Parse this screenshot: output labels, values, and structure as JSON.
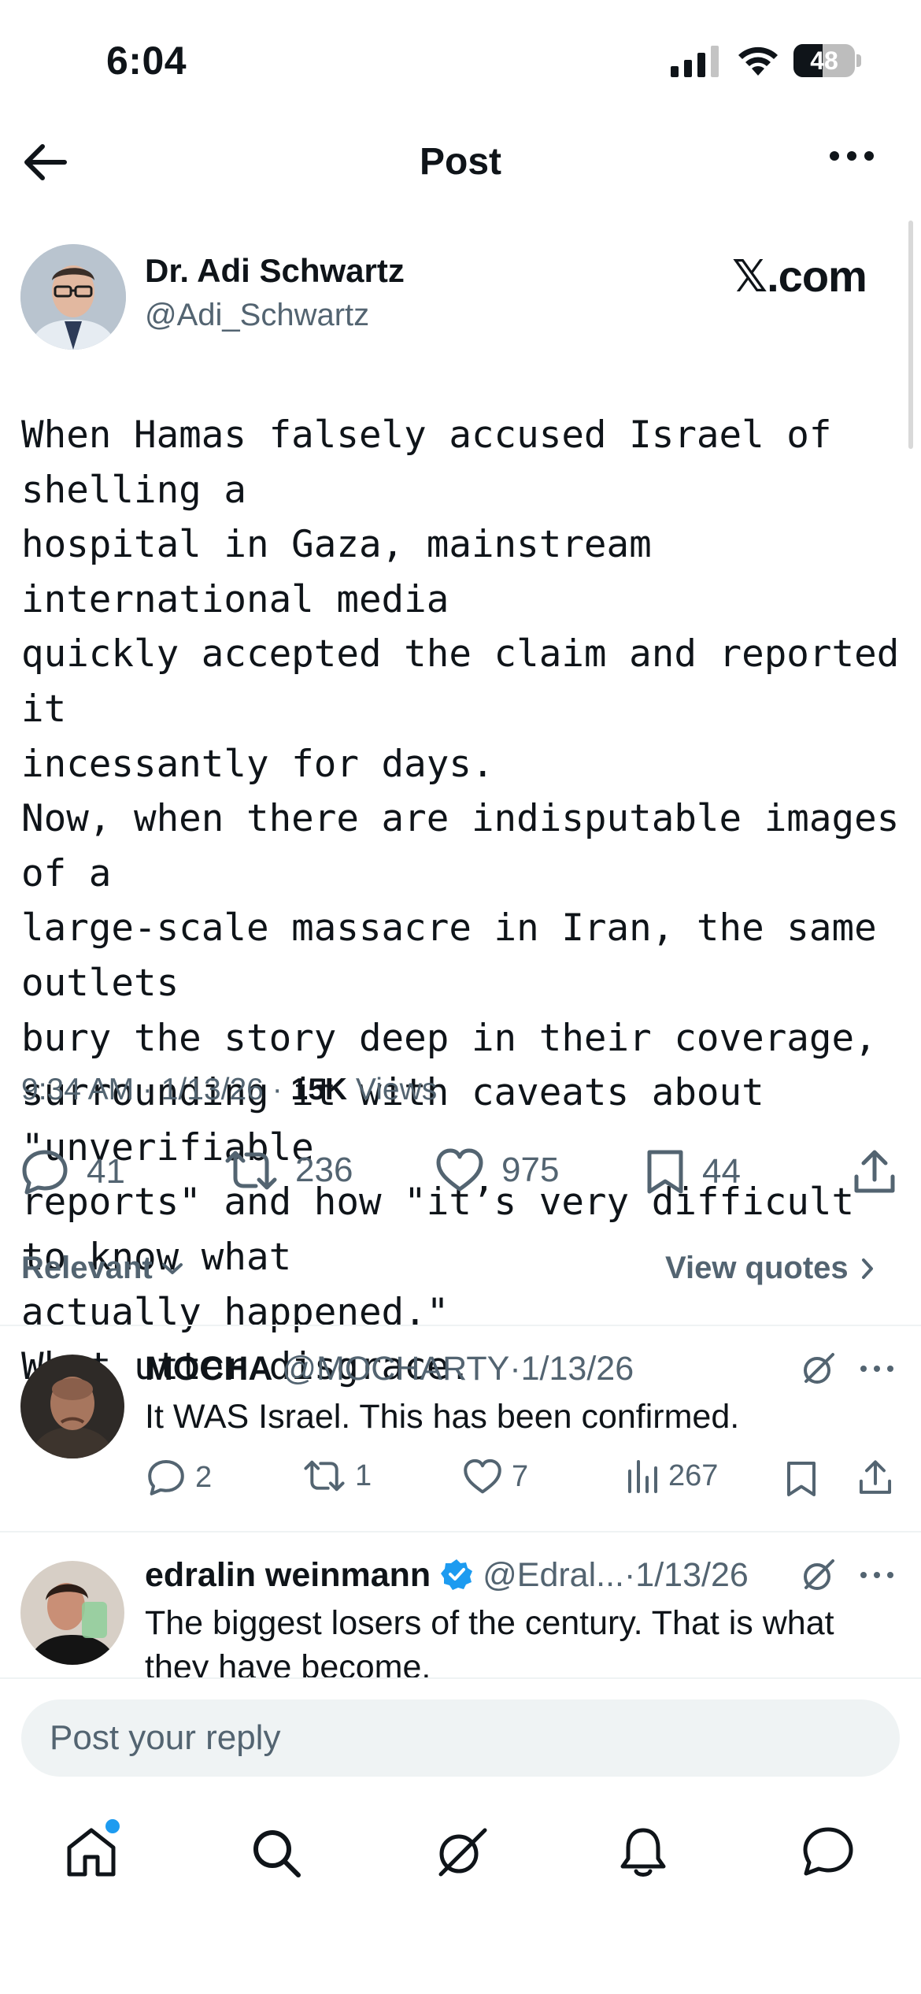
{
  "status_bar": {
    "time": "6:04",
    "battery": "48"
  },
  "nav": {
    "title": "Post"
  },
  "author": {
    "name": "Dr. Adi Schwartz",
    "handle": "@Adi_Schwartz",
    "badge": "𝕏.com"
  },
  "post": {
    "text": "When Hamas falsely accused Israel of shelling a\nhospital in Gaza, mainstream international media\nquickly accepted the claim and reported it\nincessantly for days.\nNow, when there are indisputable images of a\nlarge-scale massacre in Iran, the same outlets\nbury the story deep in their coverage,\nsurrounding it with caveats about \"unverifiable\nreports\" and how \"it’s very difficult to know what\nactually happened.\"\nWhat utter disgrace.",
    "time": "9:34 AM · 1/13/26 · ",
    "views_count": "15K",
    "views_label": " Views",
    "replies": "41",
    "reposts": "236",
    "likes": "975",
    "bookmarks": "44"
  },
  "sort": {
    "label": "Relevant",
    "view_quotes": "View quotes"
  },
  "replies": [
    {
      "name": "MOCHA",
      "handle": "@MOCHARTY",
      "date": "·1/13/26",
      "text": "It WAS Israel. This has been confirmed.",
      "replies": "2",
      "reposts": "1",
      "likes": "7",
      "views": "267"
    },
    {
      "name": "edralin weinmann",
      "handle": "@Edral...",
      "date": "·1/13/26",
      "text": "The biggest losers of the century. That is what",
      "text2": "they have become.",
      "verified": true
    }
  ],
  "reply_input": {
    "placeholder": "Post your reply"
  },
  "tabbar": [
    "home-icon",
    "search-icon",
    "grok-icon",
    "notifications-icon",
    "messages-icon"
  ],
  "colors": {
    "text": "#0f1419",
    "secondary": "#536471",
    "accent": "#1d9bf0",
    "divider": "#eff3f4"
  }
}
